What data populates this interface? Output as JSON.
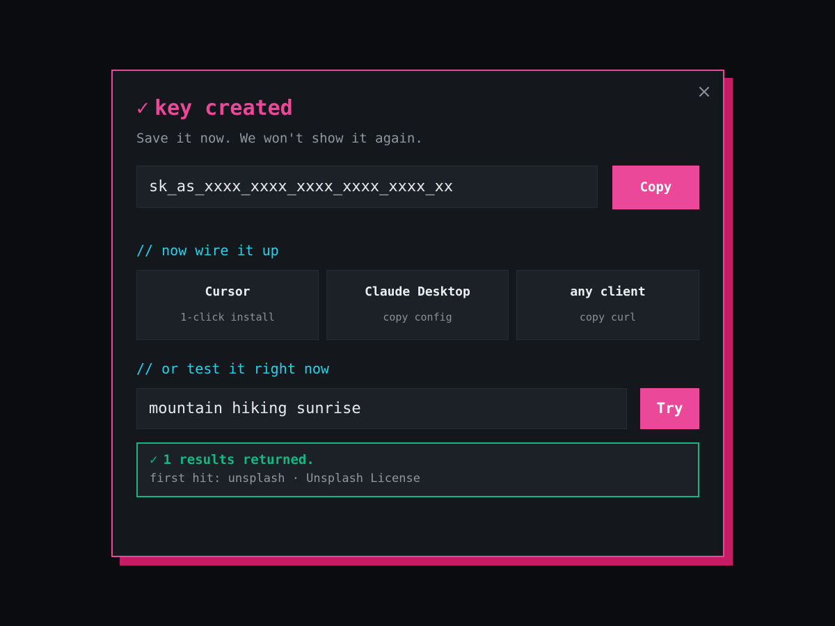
{
  "dialog": {
    "close_glyph": "×",
    "check_glyph": "✓",
    "title": "key created",
    "subtitle": "Save it now. We won't show it again.",
    "api_key": "sk_as_xxxx_xxxx_xxxx_xxxx_xxxx_xx",
    "copy_label": "Copy"
  },
  "wire": {
    "heading": "// now wire it up",
    "clients": [
      {
        "name": "Cursor",
        "subtitle": "1-click install"
      },
      {
        "name": "Claude Desktop",
        "subtitle": "copy config"
      },
      {
        "name": "any client",
        "subtitle": "copy curl"
      }
    ]
  },
  "test": {
    "heading": "// or test it right now",
    "query_value": "mountain hiking sunrise",
    "try_label": "Try",
    "result": {
      "check_glyph": "✓",
      "title": "1 results returned.",
      "detail": "first hit: unsplash · Unsplash License"
    }
  },
  "colors": {
    "accent": "#ec4899",
    "accent_shadow": "#c81b66",
    "section_heading": "#22d3ee",
    "success": "#10b981",
    "background": "#0b0c0f",
    "panel": "#14171c"
  },
  "icons": {
    "close": "close-icon",
    "check": "check-icon"
  }
}
